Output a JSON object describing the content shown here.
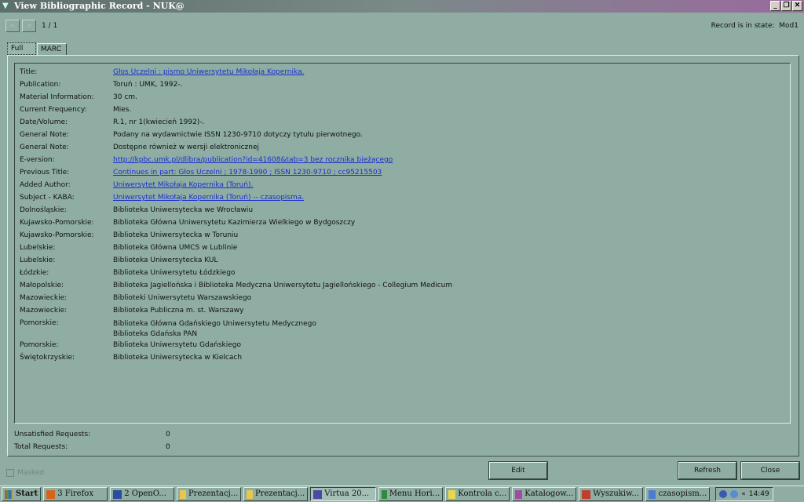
{
  "window": {
    "title": "View Bibliographic Record - NUK@"
  },
  "nav": {
    "prev": "<",
    "next": ">",
    "position": "1 / 1",
    "state_label": "Record is in state:",
    "state": "Mod1"
  },
  "tabs": [
    {
      "label": "Full",
      "active": true
    },
    {
      "label": "MARC",
      "active": false
    }
  ],
  "record": [
    {
      "label": "Title:",
      "value": "Głos Uczelni : pismo Uniwersytetu Mikołaja Kopernika.",
      "link": true
    },
    {
      "label": "Publication:",
      "value": "Toruń : UMK, 1992-."
    },
    {
      "label": "Material Information:",
      "value": "30 cm."
    },
    {
      "label": "Current Frequency:",
      "value": "Mies."
    },
    {
      "label": "Date/Volume:",
      "value": "R.1, nr 1(kwiecień 1992)-."
    },
    {
      "label": "General Note:",
      "value": "Podany na wydawnictwie ISSN 1230-9710 dotyczy tytułu pierwotnego."
    },
    {
      "label": "General Note:",
      "value": "Dostępne również w wersji elektronicznej"
    },
    {
      "label": "E-version:",
      "value": "http://kpbc.umk.pl/dlibra/publication?id=41608&tab=3 bez rocznika bieżącego",
      "link": true
    },
    {
      "label": "Previous Title:",
      "value": "Continues in part: Głos Uczelni ; 1978-1990 ; ISSN 1230-9710 ; cc95215503",
      "link": true
    },
    {
      "label": "Added Author:",
      "value": "Uniwersytet Mikołaja Kopernika (Toruń).",
      "link": true
    },
    {
      "label": "Subject - KABA:",
      "value": "Uniwersytet Mikołaja Kopernika (Toruń) -- czasopisma.",
      "link": true
    },
    {
      "label": "Dolnośląskie:",
      "value": "Biblioteka Uniwersytecka we Wrocławiu"
    },
    {
      "label": "Kujawsko-Pomorskie:",
      "value": "Biblioteka Główna Uniwersytetu Kazimierza Wielkiego w Bydgoszczy"
    },
    {
      "label": "Kujawsko-Pomorskie:",
      "value": "Biblioteka Uniwersytecka w Toruniu"
    },
    {
      "label": "Lubelskie:",
      "value": "Biblioteka Główna UMCS w Lublinie"
    },
    {
      "label": "Lubelskie:",
      "value": "Biblioteka Uniwersytecka KUL"
    },
    {
      "label": "Łódzkie:",
      "value": "Biblioteka Uniwersytetu Łódzkiego"
    },
    {
      "label": "Małopolskie:",
      "value": "Biblioteka Jagiellońska i Biblioteka Medyczna Uniwersytetu Jagiellońskiego - Collegium Medicum"
    },
    {
      "label": "Mazowieckie:",
      "value": "Biblioteki Uniwersytetu Warszawskiego"
    },
    {
      "label": "Mazowieckie:",
      "value": "Biblioteka Publiczna m. st. Warszawy"
    },
    {
      "label": "Pomorskie:",
      "value": "Biblioteka Główna Gdańskiego Uniwersytetu Medycznego",
      "value2": "Biblioteka Gdańska PAN"
    },
    {
      "label": "Pomorskie:",
      "value": "Biblioteka Uniwersytetu Gdańskiego"
    },
    {
      "label": "Świętokrzyskie:",
      "value": "Biblioteka Uniwersytecka w Kielcach"
    }
  ],
  "requests": {
    "unsatisfied_label": "Unsatisfied Requests:",
    "unsatisfied": "0",
    "total_label": "Total Requests:",
    "total": "0"
  },
  "masked_label": "Masked",
  "buttons": {
    "edit": "Edit",
    "refresh": "Refresh",
    "close": "Close"
  },
  "taskbar": {
    "start": "Start",
    "items": [
      {
        "label": "3 Firefox",
        "icon": "firefox-icon",
        "color": "#d8641c"
      },
      {
        "label": "2 OpenO...",
        "icon": "openoffice-icon",
        "color": "#2c4ca0"
      },
      {
        "label": "Prezentacj...",
        "icon": "folder-icon",
        "color": "#e8c84c"
      },
      {
        "label": "Prezentacj...",
        "icon": "folder-icon",
        "color": "#e8c84c"
      },
      {
        "label": "Virtua 20...",
        "icon": "virtua-icon",
        "color": "#4a4aa0",
        "active": true
      },
      {
        "label": "Menu Hori...",
        "icon": "app-icon",
        "color": "#2c8c3c"
      },
      {
        "label": "Kontrola c...",
        "icon": "notepad-icon",
        "color": "#e8d84c"
      },
      {
        "label": "Katalogow...",
        "icon": "image-icon",
        "color": "#a04ca0"
      },
      {
        "label": "Wyszukiw...",
        "icon": "app-icon",
        "color": "#c03c2c"
      },
      {
        "label": "czasopism...",
        "icon": "document-icon",
        "color": "#4c7cd0"
      }
    ],
    "clock": "14:49",
    "tray_arrows": "«"
  }
}
